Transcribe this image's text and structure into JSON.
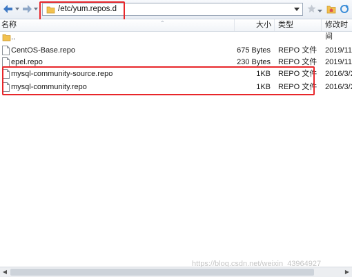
{
  "address": {
    "path": "/etc/yum.repos.d"
  },
  "columns": {
    "name": "名称",
    "size": "大小",
    "type": "类型",
    "modified": "修改时间"
  },
  "rows": [
    {
      "name": "..",
      "size": "",
      "type": "",
      "date": "",
      "icon": "folder-up-icon"
    },
    {
      "name": "CentOS-Base.repo",
      "size": "675 Bytes",
      "type": "REPO 文件",
      "date": "2019/11",
      "icon": "file-icon"
    },
    {
      "name": "epel.repo",
      "size": "230 Bytes",
      "type": "REPO 文件",
      "date": "2019/11",
      "icon": "file-icon"
    },
    {
      "name": "mysql-community-source.repo",
      "size": "1KB",
      "type": "REPO 文件",
      "date": "2016/3/2",
      "icon": "file-icon"
    },
    {
      "name": "mysql-community.repo",
      "size": "1KB",
      "type": "REPO 文件",
      "date": "2016/3/2",
      "icon": "file-icon"
    }
  ],
  "watermark": "https://blog.csdn.net/weixin_43964927",
  "colors": {
    "highlight": "#e8262a",
    "folder": "#f2c14e",
    "nav_arrow": "#3d78c4"
  }
}
